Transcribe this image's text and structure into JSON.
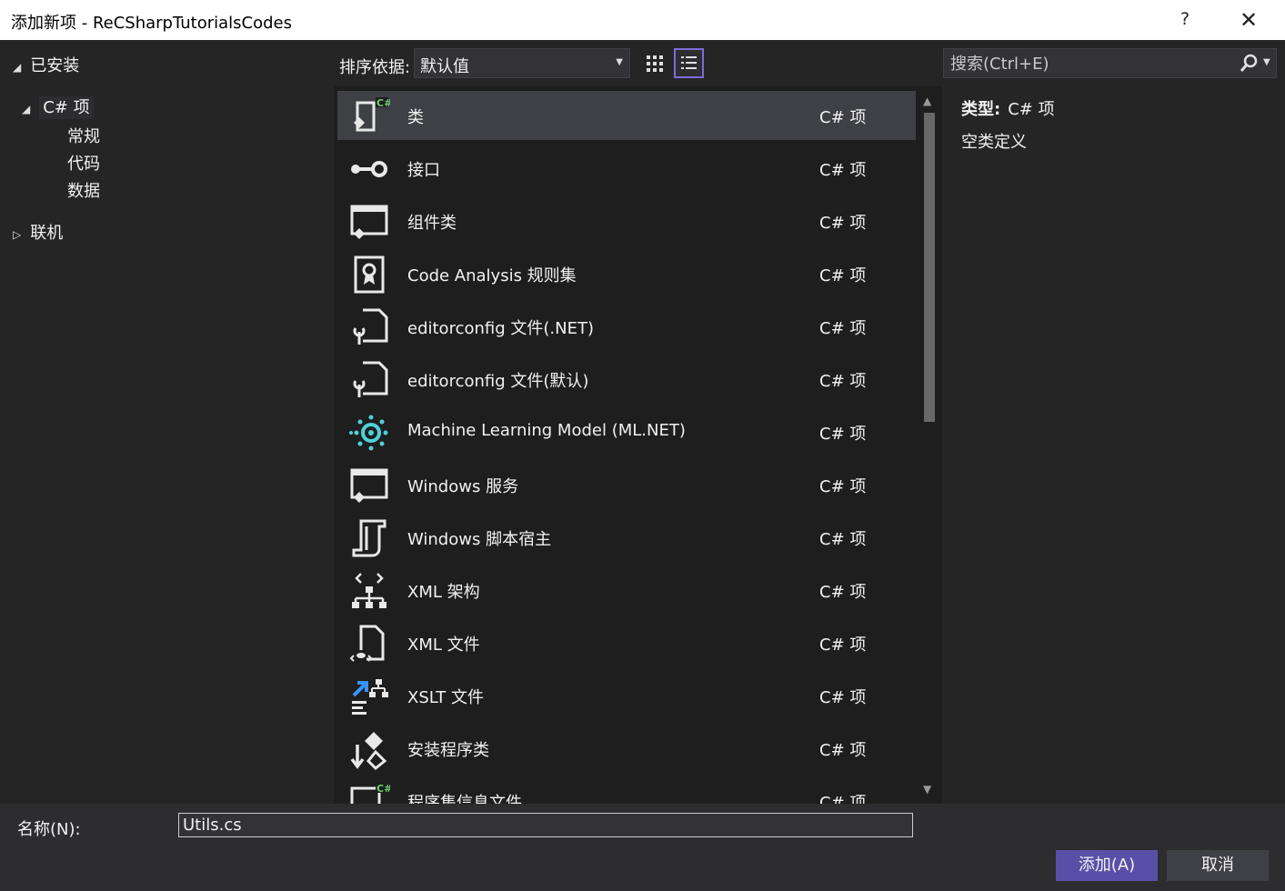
{
  "window": {
    "title": "添加新项 - ReCSharpTutorialsCodes",
    "help": "?",
    "close": "✕"
  },
  "tree": {
    "installed": "已安装",
    "csharp": "C# 项",
    "children": [
      "常规",
      "代码",
      "数据"
    ],
    "online": "联机"
  },
  "toolbar": {
    "sort_label": "排序依据:",
    "sort_value": "默认值"
  },
  "search": {
    "placeholder": "搜索(Ctrl+E)"
  },
  "templates": [
    {
      "name": "类",
      "category": "C# 项",
      "icon": "class-icon"
    },
    {
      "name": "接口",
      "category": "C# 项",
      "icon": "interface-icon"
    },
    {
      "name": "组件类",
      "category": "C# 项",
      "icon": "component-icon"
    },
    {
      "name": "Code Analysis 规则集",
      "category": "C# 项",
      "icon": "ruleset-icon"
    },
    {
      "name": "editorconfig 文件(.NET)",
      "category": "C# 项",
      "icon": "editorconfig-icon"
    },
    {
      "name": "editorconfig 文件(默认)",
      "category": "C# 项",
      "icon": "editorconfig-icon"
    },
    {
      "name": "Machine Learning Model (ML.NET)",
      "category": "C# 项",
      "icon": "ml-model-icon"
    },
    {
      "name": "Windows 服务",
      "category": "C# 项",
      "icon": "windows-service-icon"
    },
    {
      "name": "Windows 脚本宿主",
      "category": "C# 项",
      "icon": "script-host-icon"
    },
    {
      "name": "XML 架构",
      "category": "C# 项",
      "icon": "xml-schema-icon"
    },
    {
      "name": "XML 文件",
      "category": "C# 项",
      "icon": "xml-file-icon"
    },
    {
      "name": "XSLT 文件",
      "category": "C# 项",
      "icon": "xslt-icon"
    },
    {
      "name": "安装程序类",
      "category": "C# 项",
      "icon": "installer-icon"
    },
    {
      "name": "程序集信息文件",
      "category": "C# 项",
      "icon": "assembly-info-icon"
    }
  ],
  "details": {
    "type_label": "类型:",
    "type_value": "C# 项",
    "description": "空类定义"
  },
  "bottom": {
    "name_label": "名称(N):",
    "name_value": "Utils.cs",
    "add_button": "添加(A)",
    "cancel_button": "取消"
  },
  "colors": {
    "background": "#252526",
    "list_background": "#1e1e1e",
    "selected_row": "#3f3f46",
    "accent": "#5a4fa8",
    "ml_icon": "#4fd1d9",
    "xslt_arrow": "#3794ff"
  }
}
